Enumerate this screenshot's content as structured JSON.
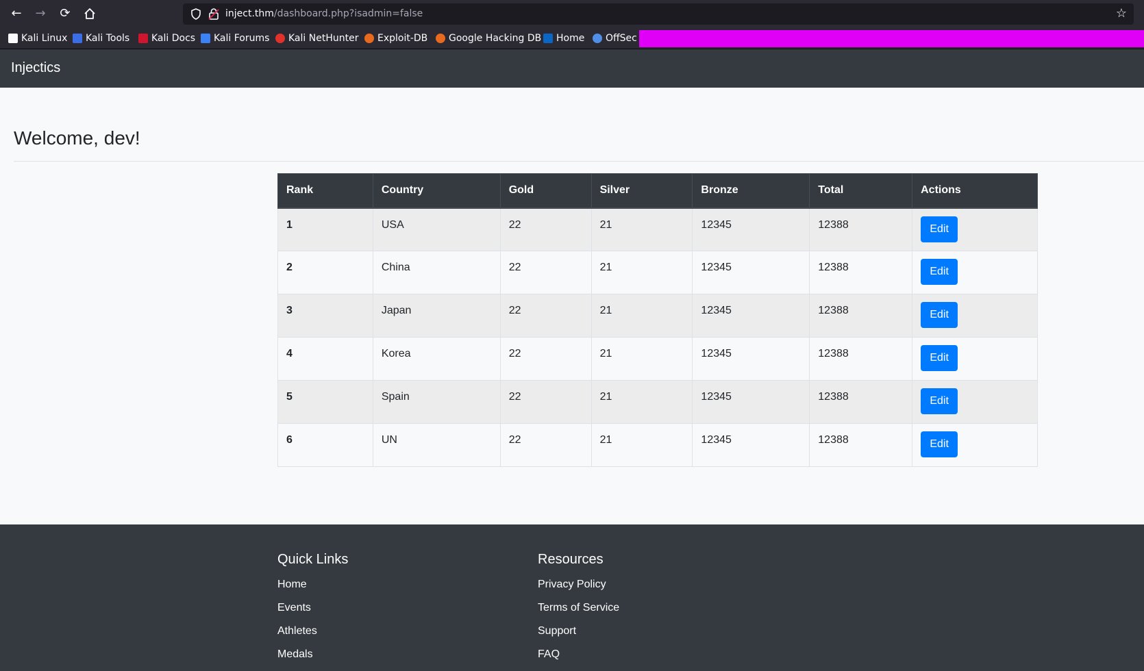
{
  "browser": {
    "url_host": "inject.thm",
    "url_path": "/dashboard.php?isadmin=false",
    "bookmarks": [
      {
        "label": "Kali Linux",
        "icon": "kali-dragon-icon",
        "color": "#fbfbfe"
      },
      {
        "label": "Kali Tools",
        "icon": "kali-tools-icon",
        "color": "#3b6ee6"
      },
      {
        "label": "Kali Docs",
        "icon": "kali-docs-icon",
        "color": "#d0162e"
      },
      {
        "label": "Kali Forums",
        "icon": "kali-forums-icon",
        "color": "#3b82f6"
      },
      {
        "label": "Kali NetHunter",
        "icon": "nethunter-icon",
        "color": "#e0312b"
      },
      {
        "label": "Exploit-DB",
        "icon": "exploit-db-icon",
        "color": "#e86a1e"
      },
      {
        "label": "Google Hacking DB",
        "icon": "ghdb-icon",
        "color": "#e86a1e"
      },
      {
        "label": "Home",
        "icon": "linkedin-icon",
        "color": "#0a66c2"
      },
      {
        "label": "OffSec",
        "icon": "offsec-icon",
        "color": "#4f8fe8"
      }
    ],
    "highlight_color": "#e000f8"
  },
  "site": {
    "brand": "Injectics",
    "welcome": "Welcome, dev!"
  },
  "table": {
    "headers": {
      "rank": "Rank",
      "country": "Country",
      "gold": "Gold",
      "silver": "Silver",
      "bronze": "Bronze",
      "total": "Total",
      "actions": "Actions"
    },
    "rows": [
      {
        "rank": "1",
        "country": "USA",
        "gold": "22",
        "silver": "21",
        "bronze": "12345",
        "total": "12388",
        "action": "Edit"
      },
      {
        "rank": "2",
        "country": "China",
        "gold": "22",
        "silver": "21",
        "bronze": "12345",
        "total": "12388",
        "action": "Edit"
      },
      {
        "rank": "3",
        "country": "Japan",
        "gold": "22",
        "silver": "21",
        "bronze": "12345",
        "total": "12388",
        "action": "Edit"
      },
      {
        "rank": "4",
        "country": "Korea",
        "gold": "22",
        "silver": "21",
        "bronze": "12345",
        "total": "12388",
        "action": "Edit"
      },
      {
        "rank": "5",
        "country": "Spain",
        "gold": "22",
        "silver": "21",
        "bronze": "12345",
        "total": "12388",
        "action": "Edit"
      },
      {
        "rank": "6",
        "country": "UN",
        "gold": "22",
        "silver": "21",
        "bronze": "12345",
        "total": "12388",
        "action": "Edit"
      }
    ]
  },
  "footer": {
    "quick_links": {
      "title": "Quick Links",
      "links": [
        "Home",
        "Events",
        "Athletes",
        "Medals"
      ]
    },
    "resources": {
      "title": "Resources",
      "links": [
        "Privacy Policy",
        "Terms of Service",
        "Support",
        "FAQ"
      ]
    }
  },
  "colors": {
    "navbar": "#343a40",
    "primary_button": "#007bff",
    "page_background": "#f8f9fa"
  }
}
